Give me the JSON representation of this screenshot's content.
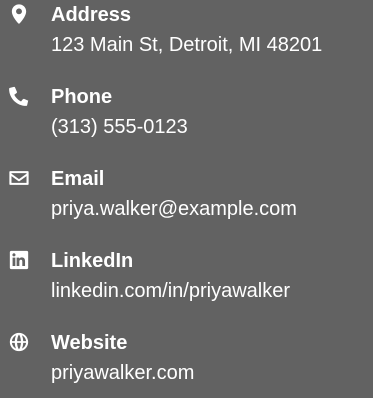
{
  "contacts": [
    {
      "icon": "map-marker-icon",
      "label": "Address",
      "value": "123 Main St, Detroit, MI 48201"
    },
    {
      "icon": "phone-icon",
      "label": "Phone",
      "value": "(313) 555-0123"
    },
    {
      "icon": "envelope-icon",
      "label": "Email",
      "value": "priya.walker@example.com"
    },
    {
      "icon": "linkedin-icon",
      "label": "LinkedIn",
      "value": "linkedin.com/in/priyawalker"
    },
    {
      "icon": "globe-icon",
      "label": "Website",
      "value": "priyawalker.com"
    }
  ],
  "colors": {
    "background": "#626262",
    "text": "#ffffff"
  }
}
